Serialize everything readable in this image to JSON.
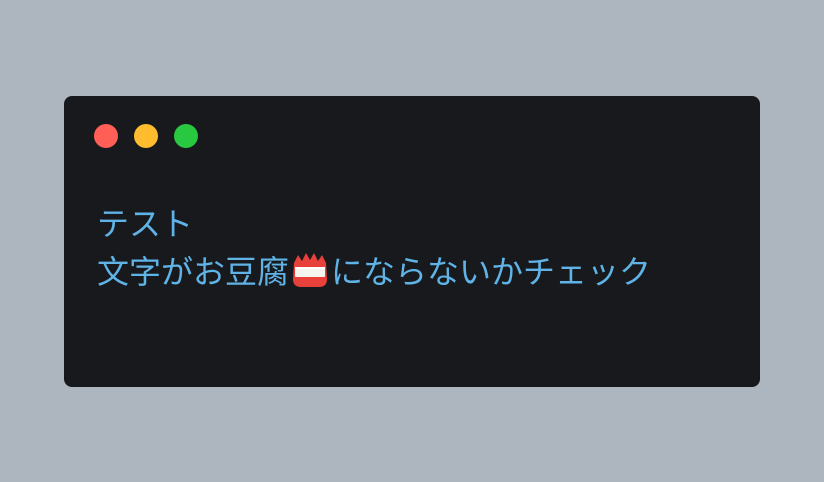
{
  "window": {
    "controls": [
      {
        "name": "close",
        "color": "#ff5f57"
      },
      {
        "name": "minimize",
        "color": "#febc2e"
      },
      {
        "name": "maximize",
        "color": "#28c840"
      }
    ]
  },
  "code": {
    "line1": "テスト",
    "line2_before": "文字がお豆腐",
    "emoji": "oden-tofu-emoji",
    "line2_after": "にならないかチェック"
  }
}
